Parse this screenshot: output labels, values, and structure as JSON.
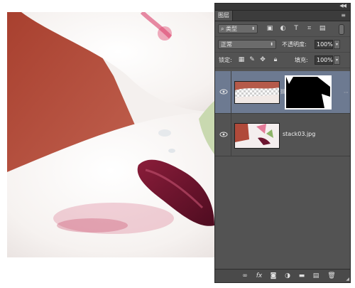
{
  "panel": {
    "tab_label": "图层",
    "filter": {
      "label": "类型"
    },
    "blend_mode": "正常",
    "opacity": {
      "label": "不透明度:",
      "value": "100%"
    },
    "lock_label": "锁定:",
    "fill": {
      "label": "填充:",
      "value": "100%"
    }
  },
  "layers": [
    {
      "name": "",
      "selected": true,
      "has_mask": true
    },
    {
      "name": "stack03.jpg",
      "selected": false,
      "has_mask": false
    }
  ],
  "icons": {
    "filter_icons": [
      "pixel-filter-icon",
      "adjustment-filter-icon",
      "type-filter-icon",
      "shape-filter-icon",
      "smart-object-filter-icon"
    ],
    "lock_icons": [
      "lock-transparent-pixels-icon",
      "lock-image-pixels-icon",
      "lock-position-icon",
      "lock-all-icon"
    ],
    "footer_icons": [
      "link-layers-icon",
      "layer-style-icon",
      "add-mask-icon",
      "adjustment-layer-icon",
      "new-group-icon",
      "new-layer-icon",
      "delete-layer-icon"
    ]
  },
  "colors": {
    "panel_bg": "#535353",
    "selected_layer": "#6d7a91",
    "canvas_left_bg": "#b04a3a"
  }
}
